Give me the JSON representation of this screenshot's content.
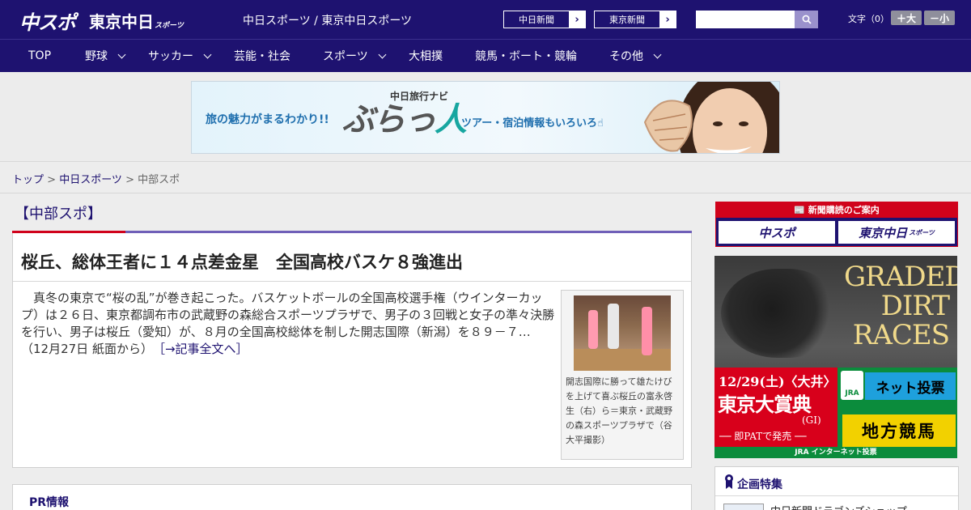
{
  "header": {
    "logo_chuspo": "中スポ",
    "logo_tokyo": "東京中日",
    "logo_tokyo_sub": "スポーツ",
    "title": "中日スポーツ / 東京中日スポーツ",
    "paper_buttons": [
      "中日新聞",
      "東京新聞"
    ],
    "search_value": "",
    "font_label": "文字（0）",
    "font_bigger": "＋大",
    "font_smaller": "－小"
  },
  "nav": {
    "items": [
      {
        "label": "TOP",
        "dropdown": false
      },
      {
        "label": "野球",
        "dropdown": true
      },
      {
        "label": "サッカー",
        "dropdown": true
      },
      {
        "label": "芸能・社会",
        "dropdown": false
      },
      {
        "label": "スポーツ",
        "dropdown": true
      },
      {
        "label": "大相撲",
        "dropdown": false
      },
      {
        "label": "競馬・ボート・競輪",
        "dropdown": false
      },
      {
        "label": "その他",
        "dropdown": true
      }
    ]
  },
  "banner": {
    "tagline": "旅の魅力がまるわかり!!",
    "navi_label": "中日旅行ナビ",
    "brand_a": "ぶらっ",
    "brand_b": "人",
    "info": "ツアー・宿泊情報もいろいろ☝"
  },
  "breadcrumb": {
    "home": "トップ",
    "sep1": " > ",
    "parent": "中日スポーツ",
    "sep2": " > ",
    "current": "中部スポ"
  },
  "section": {
    "title": "【中部スポ】"
  },
  "article": {
    "headline": "桜丘、総体王者に１４点差金星　全国高校バスケ８強進出",
    "body": "真冬の東京で“桜の乱”が巻き起こった。バスケットボールの全国高校選手権（ウインターカップ）は２６日、東京都調布市の武蔵野の森総合スポーツプラザで、男子の３回戦と女子の準々決勝を行い、男子は桜丘（愛知）が、８月の全国高校総体を制した開志国際（新潟）を８９－７…（12月27日 紙面から）",
    "more_link": "［→記事全文へ］",
    "photo_caption": "開志国際に勝って雄たけびを上げて喜ぶ桜丘の富永啓生（右）ら＝東京・武蔵野の森スポーツプラザで（谷大平撮影）"
  },
  "pr": {
    "label": "PR情報"
  },
  "sidebar": {
    "subscribe_caption": "新聞購読のご案内",
    "subscribe_chuspo": "中スポ",
    "subscribe_tokyo": "東京中日",
    "subscribe_tokyo_sub": "スポーツ",
    "ad": {
      "graded": [
        "GRADED",
        "DIRT",
        "RACES"
      ],
      "date": "12/29(土)〈大井〉",
      "race": "東京大賞典",
      "grade": "(GI)",
      "pat": "── 即PATで発売 ──",
      "jra": "JRA",
      "net": "ネット投票",
      "chiho": "地方競馬",
      "footer": "JRA インターネット投票"
    },
    "kikaku_title": "企画特集",
    "kikaku_item": "中日新聞ドラゴンズショップ"
  },
  "colors": {
    "brand_navy": "#1e1270",
    "accent_red": "#d0021b",
    "accent_purple": "#6f5fb8"
  }
}
